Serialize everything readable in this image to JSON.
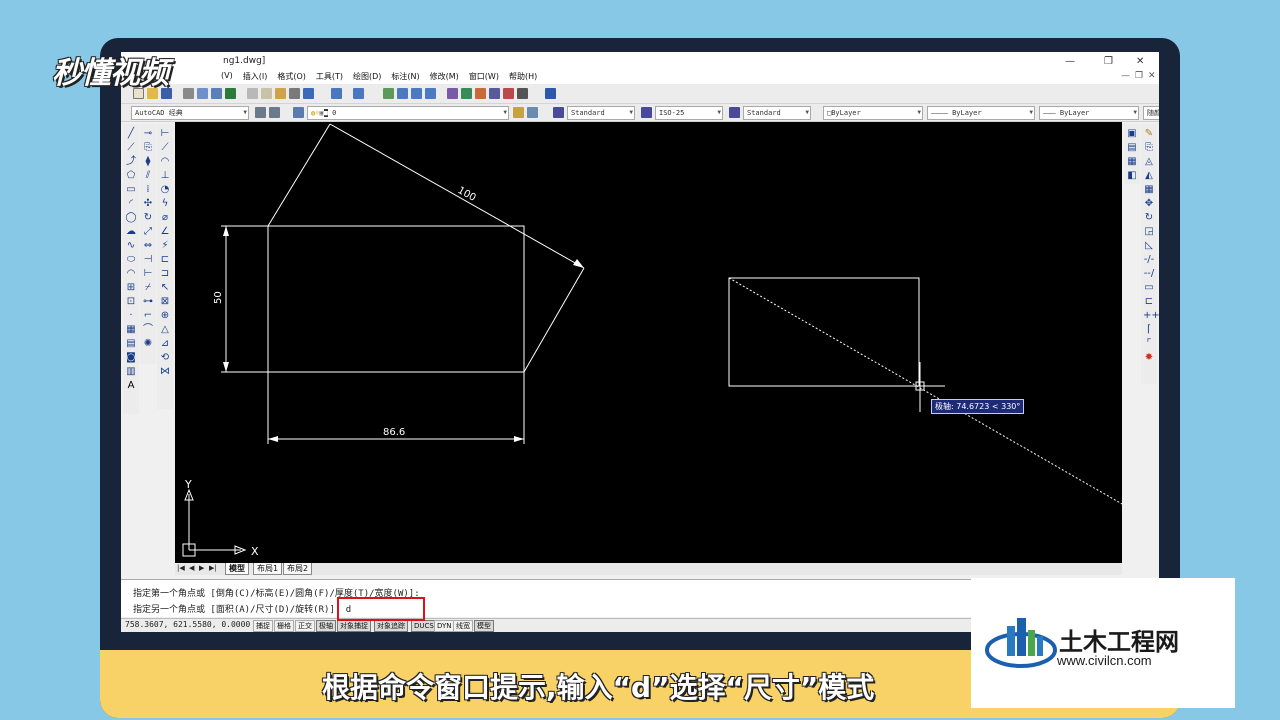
{
  "app": {
    "title_partial": "ng1.dwg]",
    "window_controls": [
      "—",
      "❐",
      "✕"
    ],
    "mdi_controls": [
      "—",
      "❐",
      "✕"
    ]
  },
  "menu": [
    "(V)",
    "插入(I)",
    "格式(O)",
    "工具(T)",
    "绘图(D)",
    "标注(N)",
    "修改(M)",
    "窗口(W)",
    "帮助(H)"
  ],
  "toolbar2": {
    "workspace": "AutoCAD 经典",
    "layer": "0",
    "text_style": "Standard",
    "dim_style": "ISO-25",
    "table_style": "Standard",
    "color": "ByLayer",
    "linetype": "ByLayer",
    "lineweight": "ByLayer",
    "plot_style": "随颜色"
  },
  "drawing": {
    "dim_top": "100",
    "dim_left": "50",
    "dim_bottom": "86.6",
    "ucs_y": "Y",
    "ucs_x": "X",
    "tooltip": "极轴: 74.6723 < 330°"
  },
  "layout_tabs": {
    "nav": [
      "|◀",
      "◀",
      "▶",
      "▶|"
    ],
    "tabs": [
      "模型",
      "布局1",
      "布局2"
    ]
  },
  "command": {
    "line1": "指定第一个角点或 [倒角(C)/标高(E)/圆角(F)/厚度(T)/宽度(W)]:",
    "line2": "指定另一个角点或 [面积(A)/尺寸(D)/旋转(R)]: d"
  },
  "status": {
    "coords": "758.3607, 621.5580, 0.0000",
    "buttons": [
      "捕捉",
      "栅格",
      "正交",
      "极轴",
      "对象捕捉",
      "对象追踪",
      "DUCS",
      "DYN",
      "线宽",
      "模型"
    ]
  },
  "overlay": {
    "logo": "秒懂视频",
    "caption": "根据命令窗口提示,输入“d”选择“尺寸”模式",
    "watermark_title": "土木工程网",
    "watermark_url": "www.civilcn.com"
  },
  "colors": {
    "canvas_bg": "#000000",
    "highlight_box": "#e0101a",
    "caption_bar": "#f8d266",
    "monitor_frame": "#17243a",
    "page_bg": "#87c8e6"
  }
}
